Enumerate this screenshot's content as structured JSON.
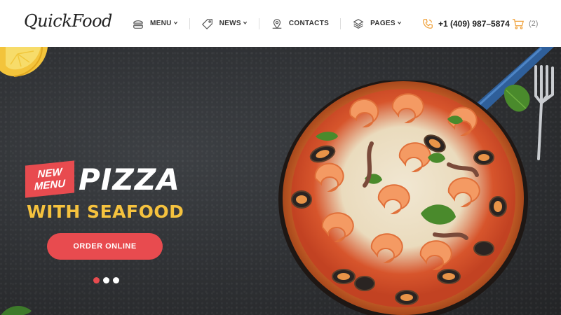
{
  "header": {
    "logo": "QuickFood",
    "nav": [
      {
        "label": "MENU",
        "icon": "burger-icon",
        "has_dropdown": true
      },
      {
        "label": "NEWS",
        "icon": "tag-icon",
        "has_dropdown": true
      },
      {
        "label": "CONTACTS",
        "icon": "map-pin-icon",
        "has_dropdown": false
      },
      {
        "label": "PAGES",
        "icon": "layers-icon",
        "has_dropdown": true
      }
    ],
    "phone": "+1 (409) 987–5874",
    "phone_icon": "phone-icon",
    "cart_count": "(2)",
    "cart_icon": "cart-icon"
  },
  "hero": {
    "badge_line1": "NEW",
    "badge_line2": "MENU",
    "title": "PIZZA",
    "subtitle": "WITH SEAFOOD",
    "cta": "ORDER ONLINE",
    "slides": 3,
    "active_slide": 1
  },
  "colors": {
    "accent": "#e84b4f",
    "subtitle": "#f5c23e",
    "header_bg": "#ffffff",
    "hero_bg": "#2e3033"
  }
}
